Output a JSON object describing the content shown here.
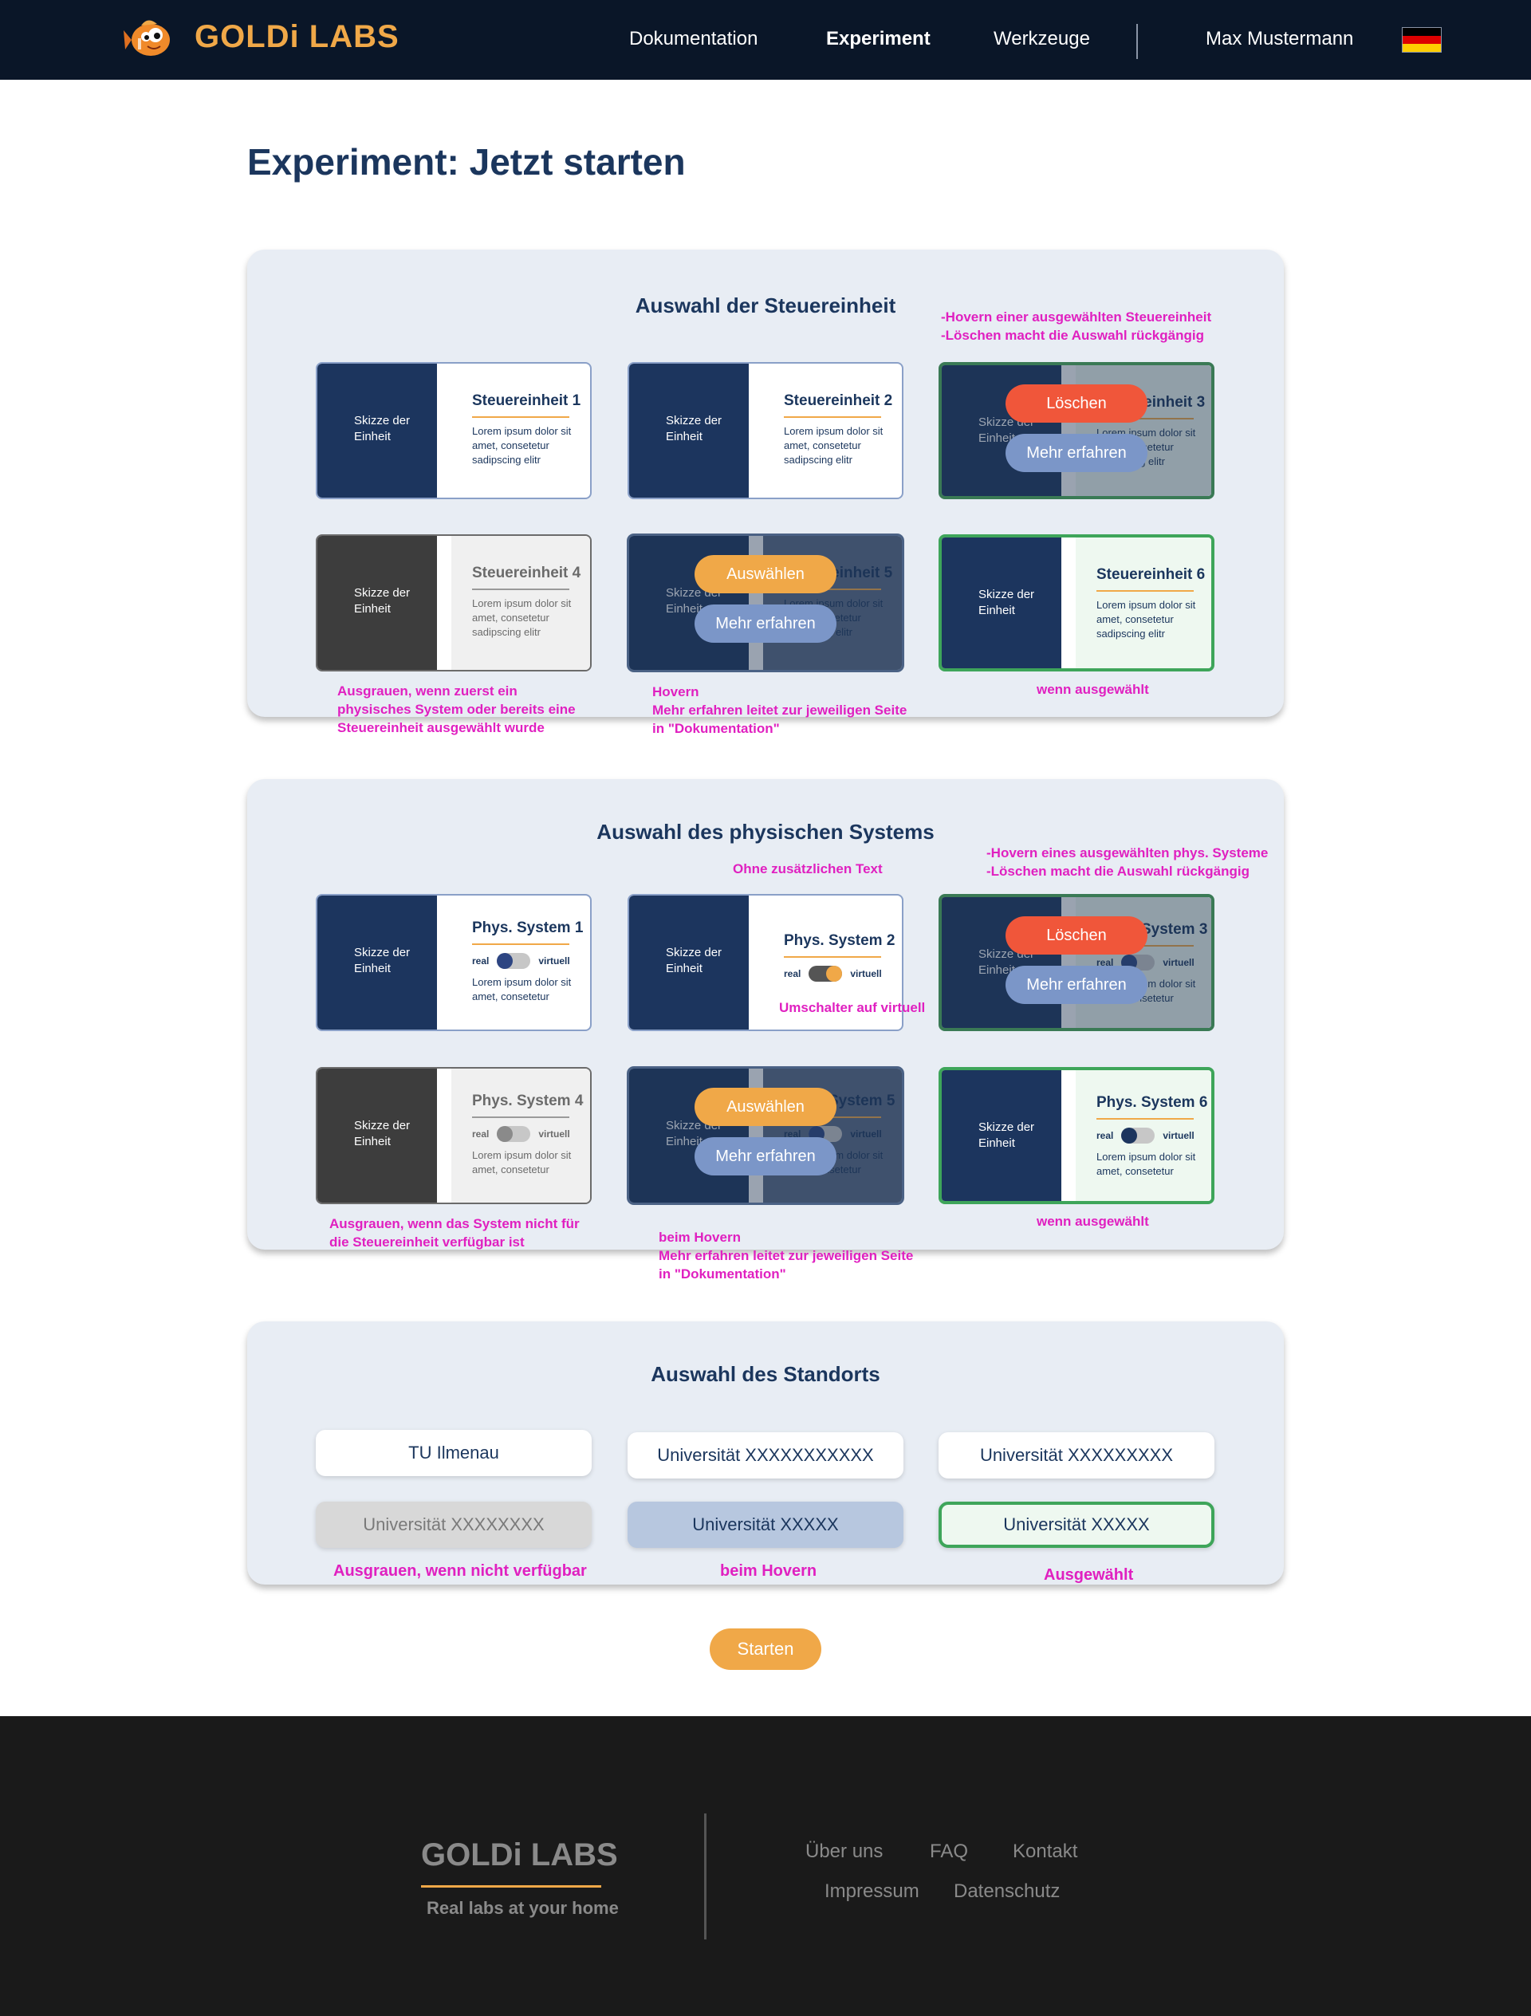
{
  "header": {
    "logo_text": "GOLDi LABS",
    "nav": [
      "Dokumentation",
      "Experiment",
      "Werkzeuge"
    ],
    "user": "Max Mustermann",
    "flag_colors": [
      "#000000",
      "#dd0000",
      "#ffce00"
    ]
  },
  "page_title": "Experiment: Jetzt starten",
  "controller_section": {
    "title": "Auswahl der Steuereinheit",
    "sketch_label": "Skizze der Einheit",
    "lorem": "Lorem ipsum dolor sit amet, consetetur sadipscing elitr",
    "cards": [
      {
        "name": "Steuereinheit 1",
        "state": "normal"
      },
      {
        "name": "Steuereinheit 2",
        "state": "normal"
      },
      {
        "name": "Steuereinheit 3",
        "state": "selected-hover"
      },
      {
        "name": "Steuereinheit 4",
        "state": "disabled"
      },
      {
        "name": "Steuereinheit 5",
        "state": "hover"
      },
      {
        "name": "Steuereinheit 6",
        "state": "selected"
      }
    ],
    "annotations": {
      "selected_hover": "-Hovern einer ausgewählten Steuereinheit\n-Löschen macht die Auswahl rückgängig",
      "disabled": "Ausgrauen, wenn zuerst ein\nphysisches System oder bereits eine\nSteuereinheit ausgewählt wurde",
      "hover": "Hovern\nMehr erfahren leitet zur jeweiligen Seite\nin \"Dokumentation\"",
      "selected": "wenn ausgewählt"
    }
  },
  "system_section": {
    "title": "Auswahl des physischen Systems",
    "sketch_label": "Skizze der Einheit",
    "lorem": "Lorem ipsum dolor sit amet, consetetur",
    "toggle_real": "real",
    "toggle_virtual": "virtuell",
    "cards": [
      {
        "name": "Phys. System 1",
        "state": "normal"
      },
      {
        "name": "Phys. System 2",
        "state": "normal"
      },
      {
        "name": "Phys. System 3",
        "state": "selected-hover"
      },
      {
        "name": "Phys. System 4",
        "state": "disabled"
      },
      {
        "name": "Phys. System 5",
        "state": "hover"
      },
      {
        "name": "Phys. System 6",
        "state": "selected"
      }
    ],
    "annotations": {
      "no_text": "Ohne zusätzlichen Text",
      "selected_hover": "-Hovern eines ausgewählten phys. Systeme\n-Löschen macht die Auswahl rückgängig",
      "toggle": "Umschalter auf virtuell",
      "disabled": "Ausgrauen, wenn das System nicht für\ndie Steuereinheit verfügbar ist",
      "hover": "beim Hovern\nMehr erfahren leitet zur jeweiligen Seite\nin \"Dokumentation\"",
      "selected": "wenn ausgewählt"
    }
  },
  "buttons": {
    "delete": "Löschen",
    "learn_more": "Mehr erfahren",
    "select": "Auswählen",
    "start": "Starten"
  },
  "location_section": {
    "title": "Auswahl des Standorts",
    "locations": [
      {
        "name": "TU Ilmenau",
        "state": "normal"
      },
      {
        "name": "Universität XXXXXXXXXXX",
        "state": "normal"
      },
      {
        "name": "Universität XXXXXXXXX",
        "state": "normal"
      },
      {
        "name": "Universität XXXXXXXX",
        "state": "disabled"
      },
      {
        "name": "Universität XXXXX",
        "state": "hover"
      },
      {
        "name": "Universität XXXXX",
        "state": "selected"
      }
    ],
    "annotations": {
      "disabled": "Ausgrauen, wenn nicht verfügbar",
      "hover": "beim Hovern",
      "selected": "Ausgewählt"
    }
  },
  "footer": {
    "logo_text": "GOLDi LABS",
    "tagline": "Real labs at your home",
    "links_row1": [
      "Über uns",
      "FAQ",
      "Kontakt"
    ],
    "links_row2": [
      "Impressum",
      "Datenschutz"
    ]
  }
}
